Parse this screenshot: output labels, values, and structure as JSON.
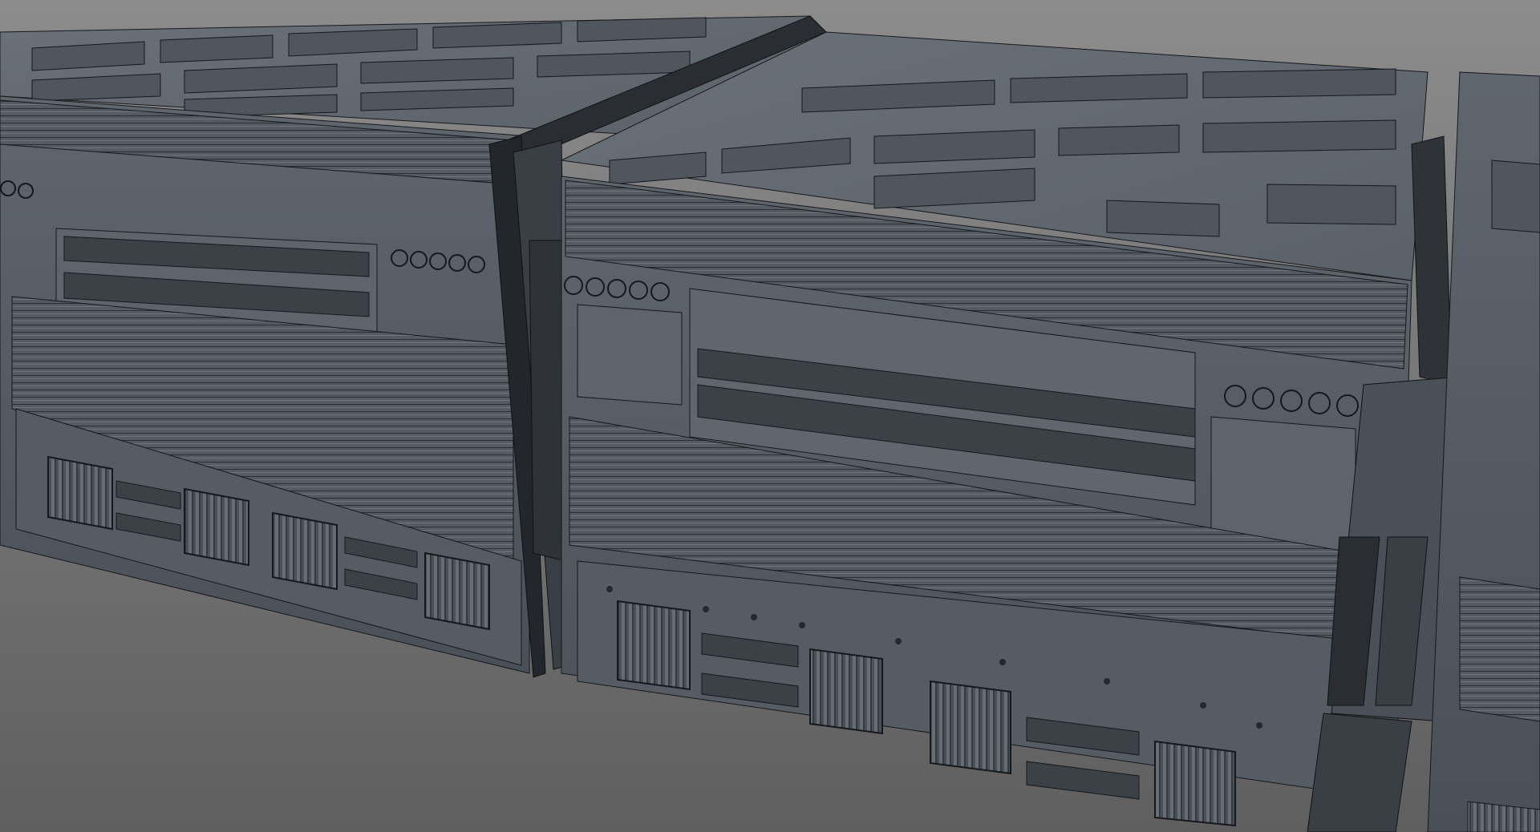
{
  "viewport": {
    "label": "",
    "colors": {
      "background_top": "#8a8a8a",
      "background_bottom": "#5e5e5e",
      "panel_light": "#6b727b",
      "panel_mid": "#575e66",
      "panel_dark": "#3c4148",
      "trim_dark": "#1f2226",
      "wire": "#16181b",
      "bolt": "#25282c"
    }
  }
}
